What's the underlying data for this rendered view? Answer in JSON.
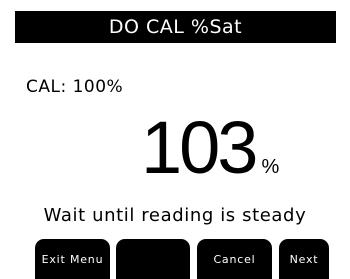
{
  "header": {
    "title": "DO CAL %Sat"
  },
  "calibration": {
    "label": "CAL: 100%"
  },
  "reading": {
    "value": "103",
    "unit": "%"
  },
  "status": {
    "message": "Wait until reading is steady"
  },
  "softkeys": [
    {
      "label": "Exit Menu"
    },
    {
      "label": ""
    },
    {
      "label": "Cancel"
    },
    {
      "label": "Next"
    }
  ]
}
